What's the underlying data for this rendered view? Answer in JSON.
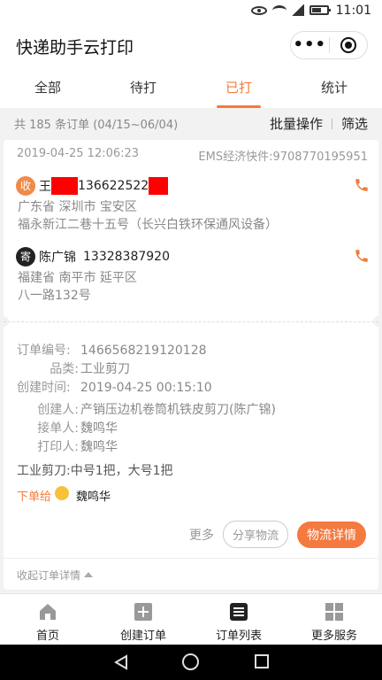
{
  "status_bar": {
    "time": "11:01"
  },
  "header": {
    "title": "快递助手云打印",
    "more_icon": "•••"
  },
  "tabs": [
    {
      "label": "全部",
      "active": false
    },
    {
      "label": "待打",
      "active": false
    },
    {
      "label": "已打",
      "active": true
    },
    {
      "label": "统计",
      "active": false
    }
  ],
  "summary": {
    "count_text": "共 185 条订单 (04/15~06/04)",
    "batch_label": "批量操作",
    "filter_label": "筛选"
  },
  "order": {
    "datetime": "2019-04-25 12:06:23",
    "carrier_waybill": "EMS经济快件:9708770195951",
    "receiver": {
      "badge": "收",
      "name": "王",
      "phone": "136622522",
      "address_line1": "广东省 深圳市 宝安区",
      "address_line2": "福永新江二巷十五号（长兴白铁环保通风设备）"
    },
    "sender": {
      "badge": "寄",
      "name": "陈广锦",
      "phone": "13328387920",
      "address_line1": "福建省 南平市 延平区",
      "address_line2": "八一路132号"
    },
    "details": [
      {
        "label": "订单编号:",
        "value": "1466568219120128"
      },
      {
        "label": "品类:",
        "value": "工业剪刀"
      },
      {
        "label": "创建时间:",
        "value": "2019-04-25 00:15:10"
      },
      {
        "label": "创建人:",
        "value": "产销压边机卷筒机铁皮剪刀(陈广锦)"
      },
      {
        "label": "接单人:",
        "value": "魏鸣华"
      },
      {
        "label": "打印人:",
        "value": "魏鸣华"
      }
    ],
    "goods_note": "工业剪刀:中号1把，大号1把",
    "assign_label": "下单给",
    "assign_name": "魏鸣华",
    "more_label": "更多",
    "share_label": "分享物流",
    "detail_label": "物流详情",
    "collapse_label": "收起订单详情"
  },
  "tabbar": [
    {
      "label": "首页",
      "icon": "home-icon"
    },
    {
      "label": "创建订单",
      "icon": "add-order-icon"
    },
    {
      "label": "订单列表",
      "icon": "order-list-icon"
    },
    {
      "label": "更多服务",
      "icon": "grid-icon"
    }
  ],
  "colors": {
    "accent": "#f27c3a",
    "button": "#f47a3f",
    "redaction": "#ff0000"
  }
}
